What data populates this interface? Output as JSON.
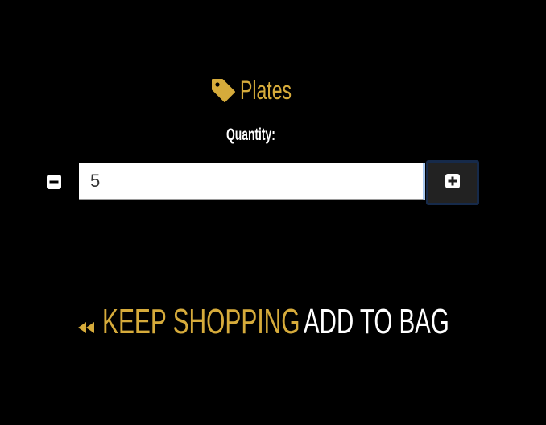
{
  "product": {
    "icon": "tag-icon",
    "name": "Plates"
  },
  "quantity": {
    "label": "Quantity:",
    "value": "5",
    "decrement_icon": "minus-square-icon",
    "increment_icon": "plus-square-icon"
  },
  "actions": {
    "keep_shopping_icon": "backward-icon",
    "keep_shopping_label": "KEEP SHOPPING",
    "add_to_bag_label": "ADD TO BAG"
  },
  "colors": {
    "background": "#000000",
    "accent": "#d6ab3b",
    "text": "#ffffff",
    "plus_button_bg": "#222222",
    "plus_button_border": "#162a4a"
  }
}
